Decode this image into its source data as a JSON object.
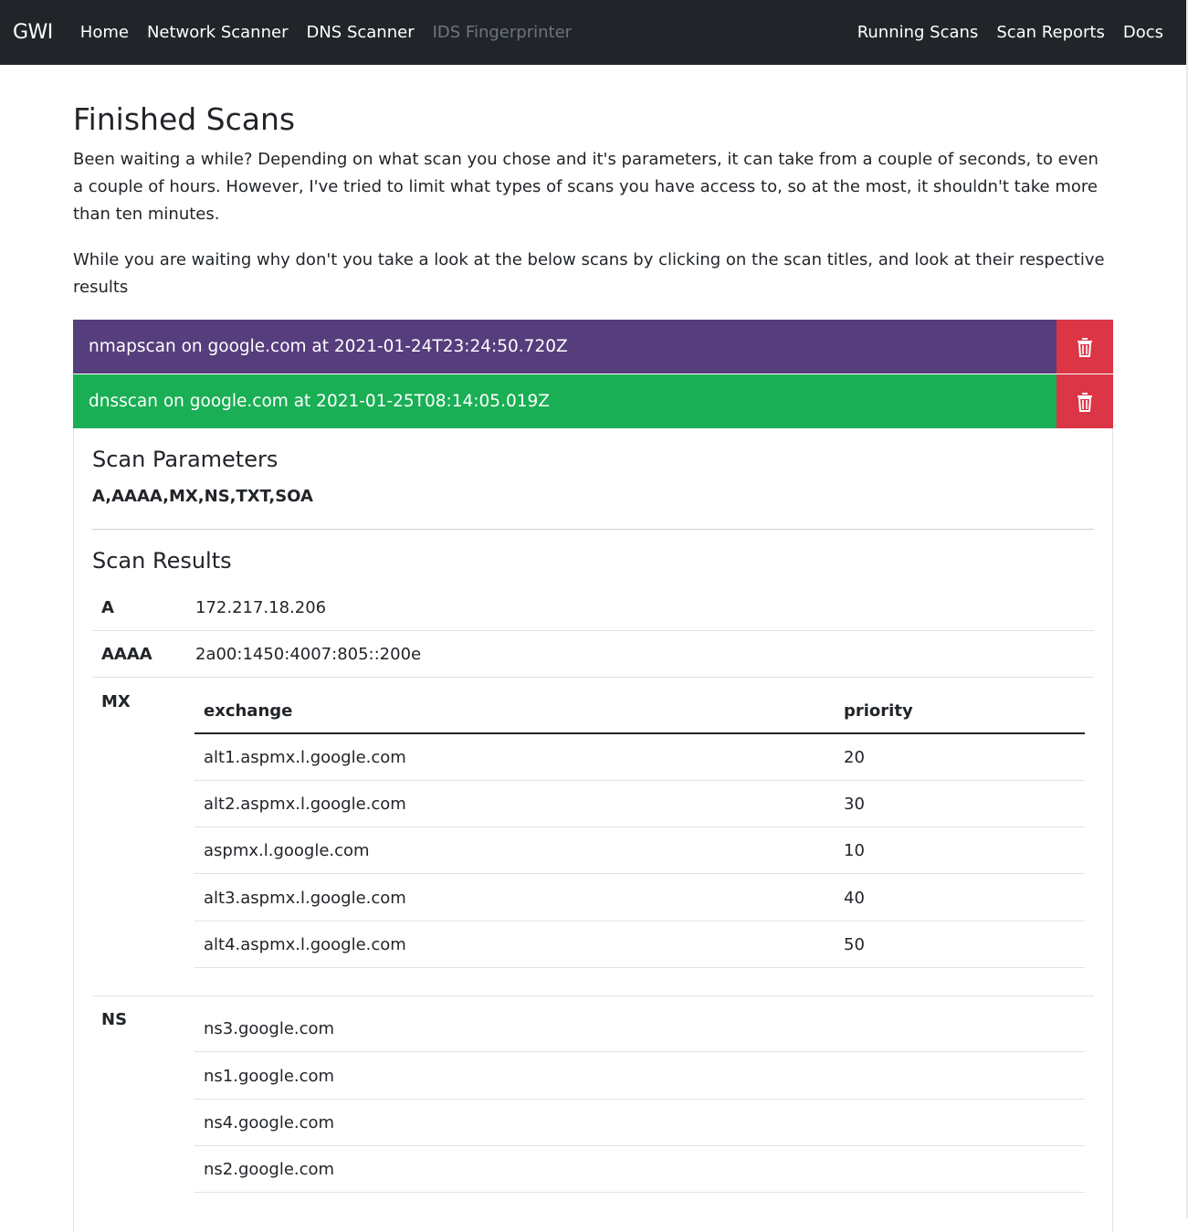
{
  "nav": {
    "brand": "GWI",
    "left": [
      "Home",
      "Network Scanner",
      "DNS Scanner",
      "IDS Fingerprinter"
    ],
    "right": [
      "Running Scans",
      "Scan Reports",
      "Docs"
    ]
  },
  "page": {
    "title": "Finished Scans",
    "intro1": "Been waiting a while? Depending on what scan you chose and it's parameters, it can take from a couple of seconds, to even a couple of hours. However, I've tried to limit what types of scans you have access to, so at the most, it shouldn't take more than ten minutes.",
    "intro2": "While you are waiting why don't you take a look at the below scans by clicking on the scan titles, and look at their respective results"
  },
  "scans": [
    {
      "title": "nmapscan on google.com at 2021-01-24T23:24:50.720Z",
      "color": "#563d7c"
    },
    {
      "title": "dnsscan on google.com at 2021-01-25T08:14:05.019Z",
      "color": "#1aaf55"
    }
  ],
  "details": {
    "params_heading": "Scan Parameters",
    "params": "A,AAAA,MX,NS,TXT,SOA",
    "results_heading": "Scan Results",
    "a": {
      "label": "A",
      "value": "172.217.18.206"
    },
    "aaaa": {
      "label": "AAAA",
      "value": "2a00:1450:4007:805::200e"
    },
    "mx": {
      "label": "MX",
      "col_exchange": "exchange",
      "col_priority": "priority",
      "rows": [
        {
          "exchange": "alt1.aspmx.l.google.com",
          "priority": "20"
        },
        {
          "exchange": "alt2.aspmx.l.google.com",
          "priority": "30"
        },
        {
          "exchange": "aspmx.l.google.com",
          "priority": "10"
        },
        {
          "exchange": "alt3.aspmx.l.google.com",
          "priority": "40"
        },
        {
          "exchange": "alt4.aspmx.l.google.com",
          "priority": "50"
        }
      ]
    },
    "ns": {
      "label": "NS",
      "rows": [
        "ns3.google.com",
        "ns1.google.com",
        "ns4.google.com",
        "ns2.google.com"
      ]
    }
  }
}
